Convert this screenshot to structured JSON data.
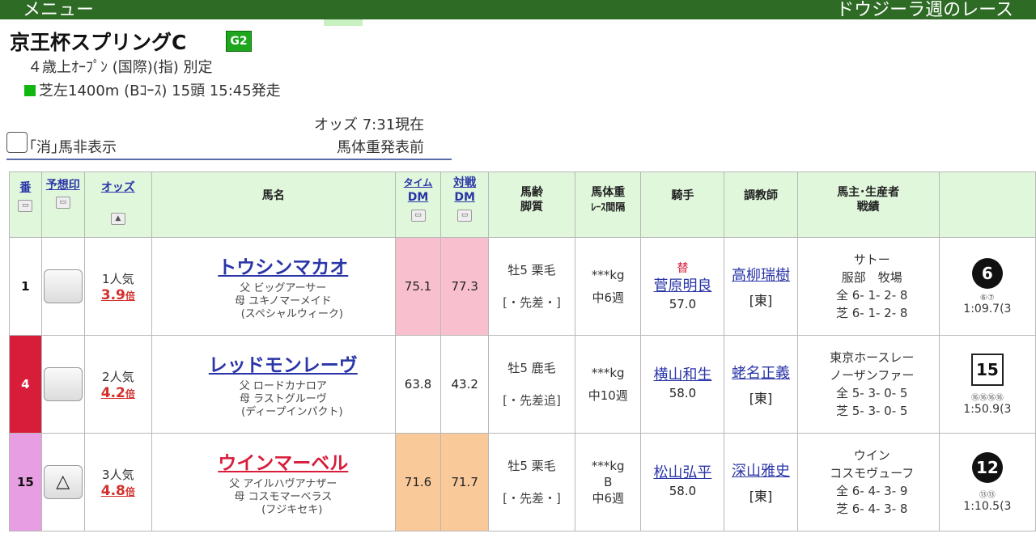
{
  "topbar": {
    "menu": "メニュー",
    "right": "ドウジーラ週のレース"
  },
  "race": {
    "title": "京王杯スプリングC",
    "grade": "G2",
    "conditions": "４歳上ｵｰﾌﾟﾝ (国際)(指) 別定",
    "course": "芝左1400m (Bｺｰｽ) 15頭 15:45発走"
  },
  "options": {
    "odds_time": "オッズ 7:31現在",
    "weight_note": "馬体重発表前",
    "hide_label": "｢消｣馬非表示"
  },
  "headers": {
    "num": "番",
    "mark": "予想印",
    "odds": "オッズ",
    "name": "馬名",
    "time_dm": [
      "タイム",
      "DM"
    ],
    "vs_dm": [
      "対戦",
      "DM"
    ],
    "age": [
      "馬齢",
      "脚質"
    ],
    "weight": [
      "馬体重",
      "ﾚｰｽ間隔"
    ],
    "jockey": "騎手",
    "trainer": "調教師",
    "owner": [
      "馬主･生産者",
      "戦績"
    ]
  },
  "entries": [
    {
      "num": "1",
      "mark": "",
      "popularity": "1人気",
      "odds": "3.9",
      "odds_unit": "倍",
      "name": "トウシンマカオ",
      "sire": "父 ビッグアーサー",
      "dam": "母 ユキノマーメイド",
      "damsire": "(スペシャルウィーク)",
      "time_dm": "75.1",
      "vs_dm": "77.3",
      "age": "牡5 栗毛",
      "style": "[・先差・]",
      "weight": "***kg",
      "weight_b": "",
      "interval": "中6週",
      "jockey_change": "替",
      "jockey": "菅原明良",
      "burden": "57.0",
      "trainer": "高柳瑞樹",
      "trainer_loc": "[東]",
      "owner": "サトー",
      "breeder": "服部　牧場",
      "record_all": "全 6- 1- 2- 8",
      "record_turf": "芝 6- 1- 2- 8",
      "last_pos": "6",
      "last_corner": "⑥⑦",
      "last_time": "1:09.7(3"
    },
    {
      "num": "4",
      "mark": "",
      "popularity": "2人気",
      "odds": "4.2",
      "odds_unit": "倍",
      "name": "レッドモンレーヴ",
      "sire": "父 ロードカナロア",
      "dam": "母 ラストグルーヴ",
      "damsire": "(ディープインパクト)",
      "time_dm": "63.8",
      "vs_dm": "43.2",
      "age": "牡5 鹿毛",
      "style": "[・先差追]",
      "weight": "***kg",
      "weight_b": "",
      "interval": "中10週",
      "jockey_change": "",
      "jockey": "横山和生",
      "burden": "58.0",
      "trainer": "蛯名正義",
      "trainer_loc": "[東]",
      "owner": "東京ホースレー",
      "breeder": "ノーザンファー",
      "record_all": "全 5- 3- 0- 5",
      "record_turf": "芝 5- 3- 0- 5",
      "last_pos": "15",
      "last_corner": "⑯⑯⑯⑯",
      "last_time": "1:50.9(3"
    },
    {
      "num": "15",
      "mark": "△",
      "popularity": "3人気",
      "odds": "4.8",
      "odds_unit": "倍",
      "name": "ウインマーベル",
      "sire": "父 アイルハヴアナザー",
      "dam": "母 コスモマーベラス",
      "damsire": "(フジキセキ)",
      "time_dm": "71.6",
      "vs_dm": "71.7",
      "age": "牡5 栗毛",
      "style": "[・先差・]",
      "weight": "***kg",
      "weight_b": "B",
      "interval": "中6週",
      "jockey_change": "",
      "jockey": "松山弘平",
      "burden": "58.0",
      "trainer": "深山雅史",
      "trainer_loc": "[東]",
      "owner": "ウイン",
      "breeder": "コスモヴューフ",
      "record_all": "全 6- 4- 3- 9",
      "record_turf": "芝 6- 4- 3- 8",
      "last_pos": "12",
      "last_corner": "⑬⑬",
      "last_time": "1:10.5(3"
    }
  ],
  "colors": {
    "header_bar": "#2e6b25",
    "header_cell": "#e0f7dc",
    "frame_1": "#ffffff",
    "frame_4": "#d81d3b",
    "frame_15": "#e79ee2",
    "dm_pink": "#f8c0cf",
    "dm_orange": "#f9c99a",
    "link": "#2a35a8",
    "odds": "#d3302c"
  }
}
